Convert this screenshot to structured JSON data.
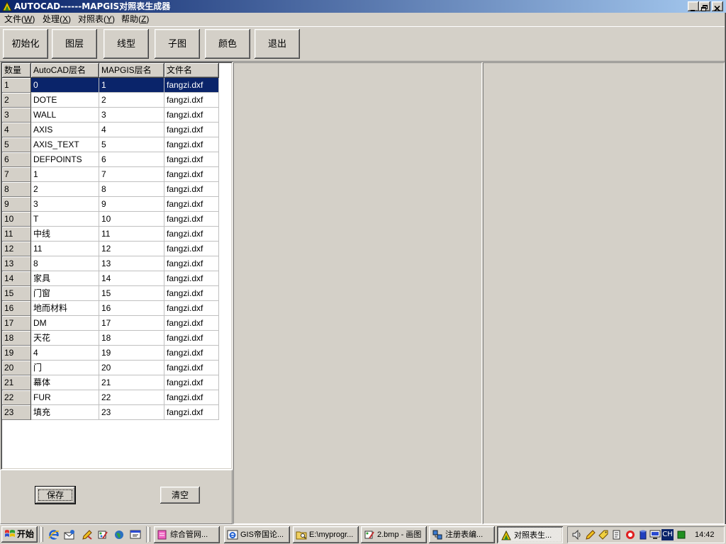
{
  "theme": {
    "face": "#d4d0c8",
    "titlebar_start": "#0a246a",
    "titlebar_end": "#a6caf0",
    "selection": "#0a246a",
    "grid_line": "#c0c0c0"
  },
  "window": {
    "title": "AUTOCAD------MAPGIS对照表生成器",
    "icon": "autocad-mapgis-app-icon"
  },
  "menu": [
    {
      "label": "文件(W)"
    },
    {
      "label": "处理(X)"
    },
    {
      "label": "对照表(Y)"
    },
    {
      "label": "帮助(Z)"
    }
  ],
  "toolbar": [
    {
      "label": "初始化"
    },
    {
      "label": "图层"
    },
    {
      "label": "线型"
    },
    {
      "label": "子图"
    },
    {
      "label": "颜色"
    },
    {
      "label": "退出"
    }
  ],
  "grid": {
    "columns": [
      "数量",
      "AutoCAD层名",
      "MAPGIS层名",
      "文件名"
    ],
    "selected_row": 1,
    "rows": [
      [
        "1",
        "0",
        "1",
        "fangzi.dxf"
      ],
      [
        "2",
        "DOTE",
        "2",
        "fangzi.dxf"
      ],
      [
        "3",
        "WALL",
        "3",
        "fangzi.dxf"
      ],
      [
        "4",
        "AXIS",
        "4",
        "fangzi.dxf"
      ],
      [
        "5",
        "AXIS_TEXT",
        "5",
        "fangzi.dxf"
      ],
      [
        "6",
        "DEFPOINTS",
        "6",
        "fangzi.dxf"
      ],
      [
        "7",
        "1",
        "7",
        "fangzi.dxf"
      ],
      [
        "8",
        "2",
        "8",
        "fangzi.dxf"
      ],
      [
        "9",
        "3",
        "9",
        "fangzi.dxf"
      ],
      [
        "10",
        "T",
        "10",
        "fangzi.dxf"
      ],
      [
        "11",
        "中线",
        "11",
        "fangzi.dxf"
      ],
      [
        "12",
        "11",
        "12",
        "fangzi.dxf"
      ],
      [
        "13",
        "8",
        "13",
        "fangzi.dxf"
      ],
      [
        "14",
        "家具",
        "14",
        "fangzi.dxf"
      ],
      [
        "15",
        "门窗",
        "15",
        "fangzi.dxf"
      ],
      [
        "16",
        "地而材料",
        "16",
        "fangzi.dxf"
      ],
      [
        "17",
        "DM",
        "17",
        "fangzi.dxf"
      ],
      [
        "18",
        "天花",
        "18",
        "fangzi.dxf"
      ],
      [
        "19",
        "4",
        "19",
        "fangzi.dxf"
      ],
      [
        "20",
        "门",
        "20",
        "fangzi.dxf"
      ],
      [
        "21",
        "幕体",
        "21",
        "fangzi.dxf"
      ],
      [
        "22",
        "FUR",
        "22",
        "fangzi.dxf"
      ],
      [
        "23",
        "填充",
        "23",
        "fangzi.dxf"
      ]
    ]
  },
  "actions": {
    "save_label": "保存",
    "clear_label": "清空"
  },
  "taskbar": {
    "start_label": "开始",
    "quick_launch": [
      "ie-icon",
      "outlook-express-icon",
      "tool-icon",
      "paint-icon",
      "browser-icon",
      "show-desktop-icon"
    ],
    "tasks": [
      {
        "label": "综合管网...",
        "icon": "web-page-icon",
        "active": false
      },
      {
        "label": "GIS帝国论...",
        "icon": "ie-icon",
        "active": false
      },
      {
        "label": "E:\\myprogr...",
        "icon": "explorer-icon",
        "active": false
      },
      {
        "label": "2.bmp - 画图",
        "icon": "paint-icon",
        "active": false
      },
      {
        "label": "注册表编...",
        "icon": "regedit-icon",
        "active": false
      },
      {
        "label": "对照表生...",
        "icon": "autocad-mapgis-app-icon",
        "active": true
      }
    ],
    "tray": {
      "input_method": "CH",
      "clock": "14:42"
    }
  }
}
